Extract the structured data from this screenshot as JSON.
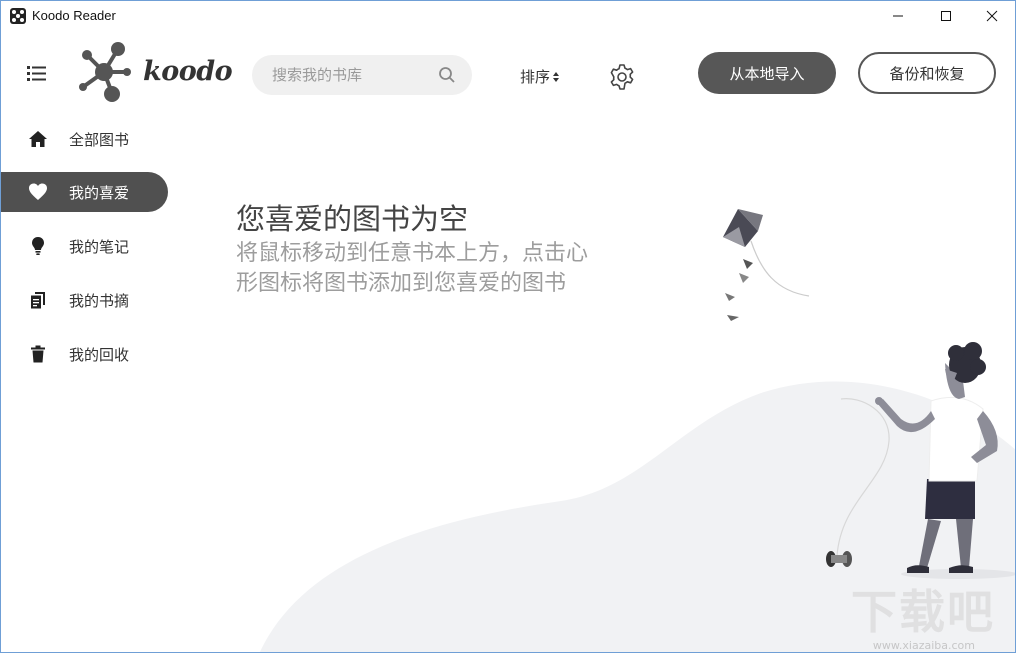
{
  "window": {
    "title": "Koodo Reader"
  },
  "header": {
    "logo_text": "koodo",
    "search_placeholder": "搜索我的书库",
    "sort_label": "排序",
    "import_label": "从本地导入",
    "backup_label": "备份和恢复"
  },
  "sidebar": {
    "items": [
      {
        "label": "全部图书",
        "icon": "home-icon",
        "active": false
      },
      {
        "label": "我的喜爱",
        "icon": "heart-icon",
        "active": true
      },
      {
        "label": "我的笔记",
        "icon": "lightbulb-icon",
        "active": false
      },
      {
        "label": "我的书摘",
        "icon": "copy-icon",
        "active": false
      },
      {
        "label": "我的回收",
        "icon": "trash-icon",
        "active": false
      }
    ]
  },
  "main": {
    "empty_title": "您喜爱的图书为空",
    "empty_desc_line1": "将鼠标移动到任意书本上方，点击心",
    "empty_desc_line2": "形图标将图书添加到您喜爱的图书"
  },
  "watermark": {
    "text": "下载吧",
    "url": "www.xiazaiba.com"
  },
  "colors": {
    "accent": "#575757",
    "active_nav": "#505050",
    "desc_text": "#9d9d9d",
    "hill": "#f1f2f4"
  }
}
